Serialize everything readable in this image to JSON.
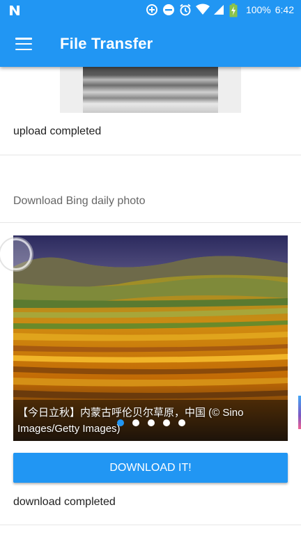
{
  "status_bar": {
    "battery_text": "100%",
    "time": "6:42",
    "icons": [
      "n-notification-icon",
      "data-saver-icon",
      "do-not-disturb-icon",
      "alarm-icon",
      "wifi-icon",
      "signal-icon",
      "battery-charging-icon"
    ]
  },
  "app_bar": {
    "title": "File Transfer",
    "menu_icon": "hamburger-menu-icon"
  },
  "upload": {
    "status": "upload completed"
  },
  "download": {
    "section_title": "Download Bing daily photo",
    "caption": "【今日立秋】内蒙古呼伦贝尔草原，中国 (© Sino Images/Getty Images)",
    "carousel": {
      "count": 5,
      "active_index": 0
    },
    "button_label": "DOWNLOAD IT!",
    "status": "download completed"
  },
  "colors": {
    "primary": "#2196F3",
    "text_primary": "#212121",
    "text_secondary": "#666666"
  }
}
